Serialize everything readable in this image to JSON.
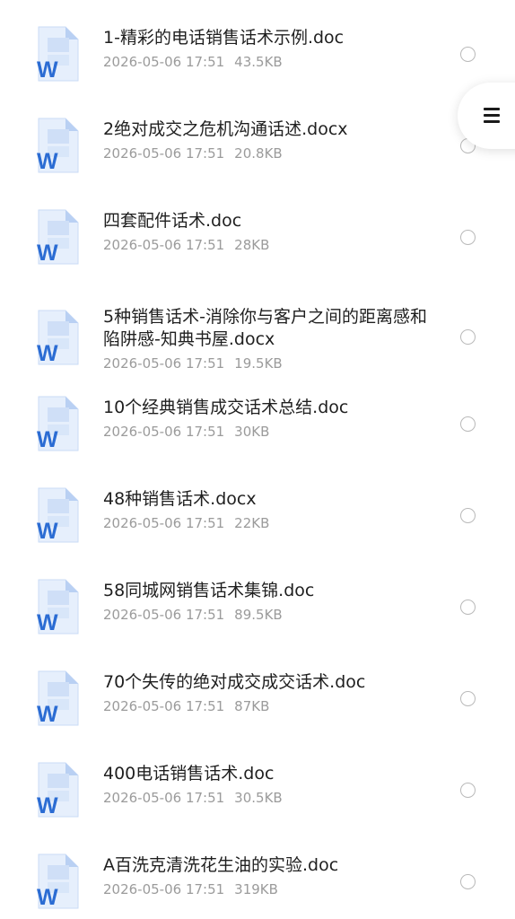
{
  "files": [
    {
      "name": "1-精彩的电话销售话术示例.doc",
      "date": "2026-05-06 17:51",
      "size": "43.5KB",
      "icon": "word-doc-icon",
      "selected": false
    },
    {
      "name": "2绝对成交之危机沟通话述.docx",
      "date": "2026-05-06 17:51",
      "size": "20.8KB",
      "icon": "word-doc-icon",
      "selected": false
    },
    {
      "name": "四套配件话术.doc",
      "date": "2026-05-06 17:51",
      "size": "28KB",
      "icon": "word-doc-icon",
      "selected": false
    },
    {
      "name": "5种销售话术-消除你与客户之间的距离感和陷阱感-知典书屋.docx",
      "date": "2026-05-06 17:51",
      "size": "19.5KB",
      "icon": "word-doc-icon",
      "selected": false
    },
    {
      "name": "10个经典销售成交话术总结.doc",
      "date": "2026-05-06 17:51",
      "size": "30KB",
      "icon": "word-doc-icon",
      "selected": false
    },
    {
      "name": "48种销售话术.docx",
      "date": "2026-05-06 17:51",
      "size": "22KB",
      "icon": "word-doc-icon",
      "selected": false
    },
    {
      "name": "58同城网销售话术集锦.doc",
      "date": "2026-05-06 17:51",
      "size": "89.5KB",
      "icon": "word-doc-icon",
      "selected": false
    },
    {
      "name": "70个失传的绝对成交成交话术.doc",
      "date": "2026-05-06 17:51",
      "size": "87KB",
      "icon": "word-doc-icon",
      "selected": false
    },
    {
      "name": "400电话销售话术.doc",
      "date": "2026-05-06 17:51",
      "size": "30.5KB",
      "icon": "word-doc-icon",
      "selected": false
    },
    {
      "name": "A百洗克清洗花生油的实验.doc",
      "date": "2026-05-06 17:51",
      "size": "319KB",
      "icon": "word-doc-icon",
      "selected": false
    }
  ],
  "fab": {
    "icon": "menu-icon"
  },
  "colors": {
    "word_blue": "#2b6cd3",
    "word_light": "#dbe8fb",
    "text": "#1f1f1f",
    "meta": "#9b9b9b",
    "radio_border": "#b9b9b9"
  }
}
